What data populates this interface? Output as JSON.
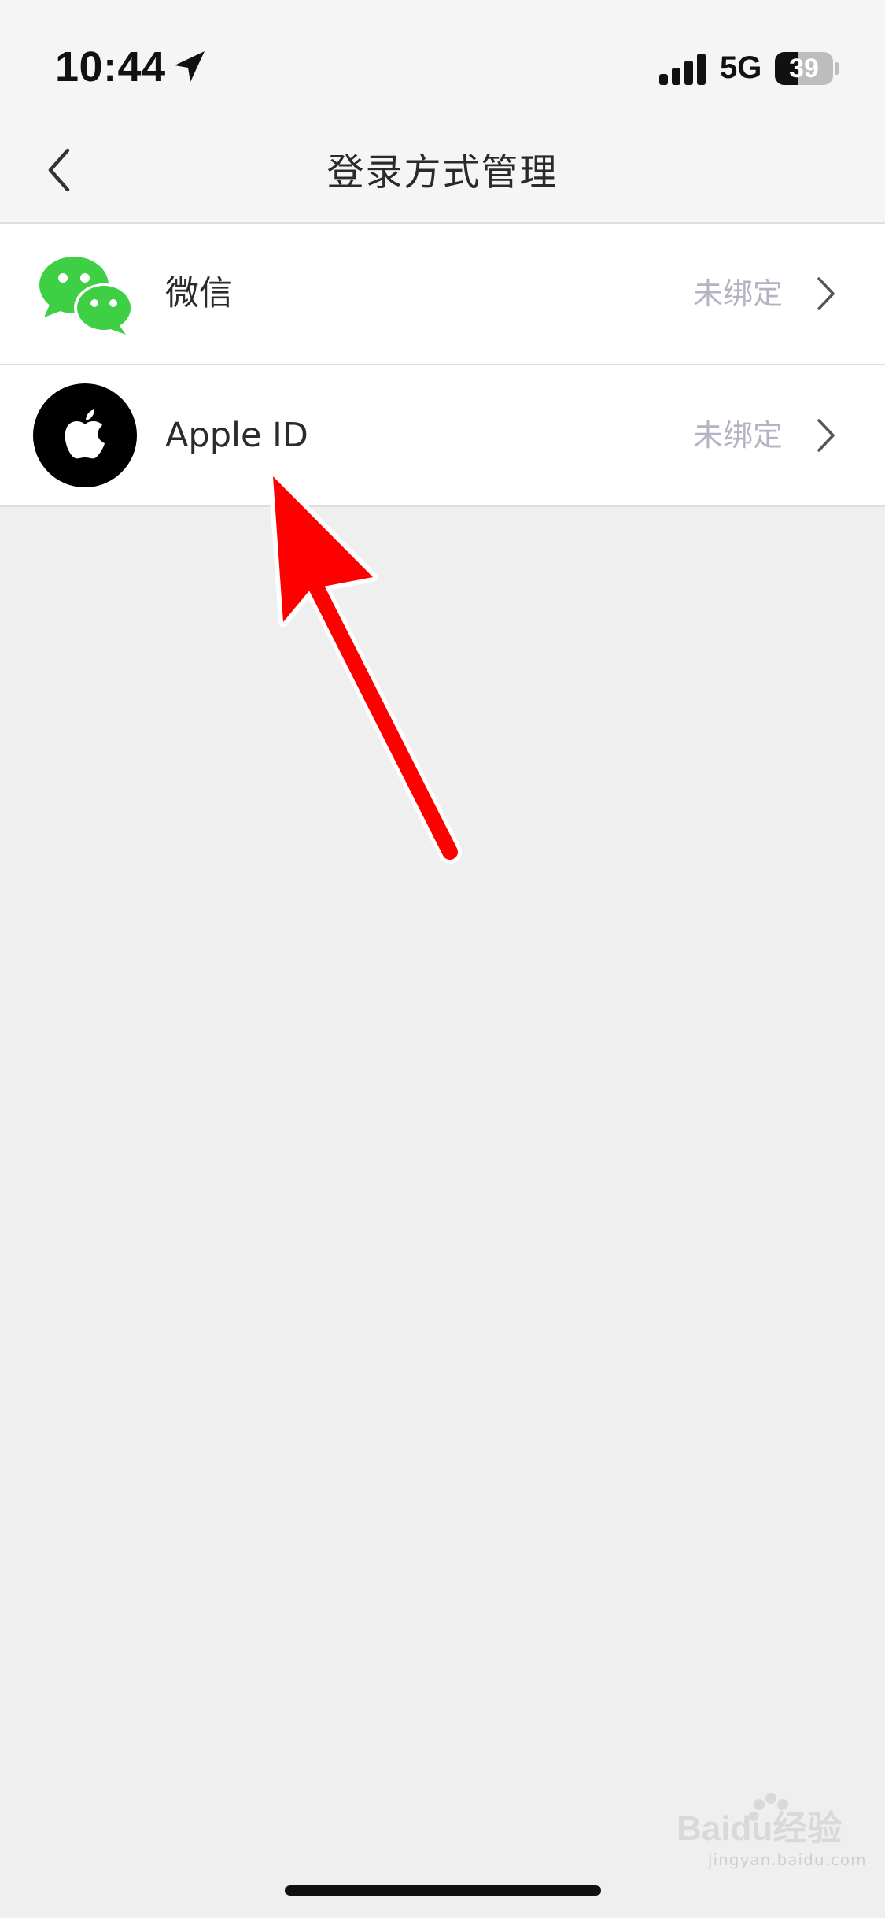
{
  "status_bar": {
    "time": "10:44",
    "network": "5G",
    "battery_level": "39",
    "battery_fraction": 0.39,
    "icons": [
      "location-arrow-icon",
      "cellular-signal-icon",
      "battery-icon"
    ]
  },
  "nav": {
    "back_icon": "chevron-left-icon",
    "title": "登录方式管理"
  },
  "login_methods": [
    {
      "name": "微信",
      "icon": "wechat-icon",
      "status": "未绑定"
    },
    {
      "name": "Apple ID",
      "icon": "apple-logo-icon",
      "status": "未绑定"
    }
  ],
  "watermark": {
    "text": "Baidu经验",
    "sub": "jingyan.baidu.com"
  },
  "colors": {
    "page_background": "#efefef",
    "bar_background": "#f5f5f5",
    "wechat_green": "#3fcf45",
    "status_gray": "#b3b3c3",
    "annotation_red": "#ff0000"
  }
}
